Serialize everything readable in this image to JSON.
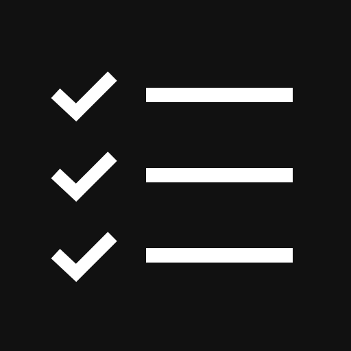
{
  "icon": {
    "name": "checklist-icon",
    "background_color": "#111111",
    "foreground_color": "#FFFFFF",
    "rows": [
      {
        "checked": true
      },
      {
        "checked": true
      },
      {
        "checked": true
      }
    ]
  }
}
